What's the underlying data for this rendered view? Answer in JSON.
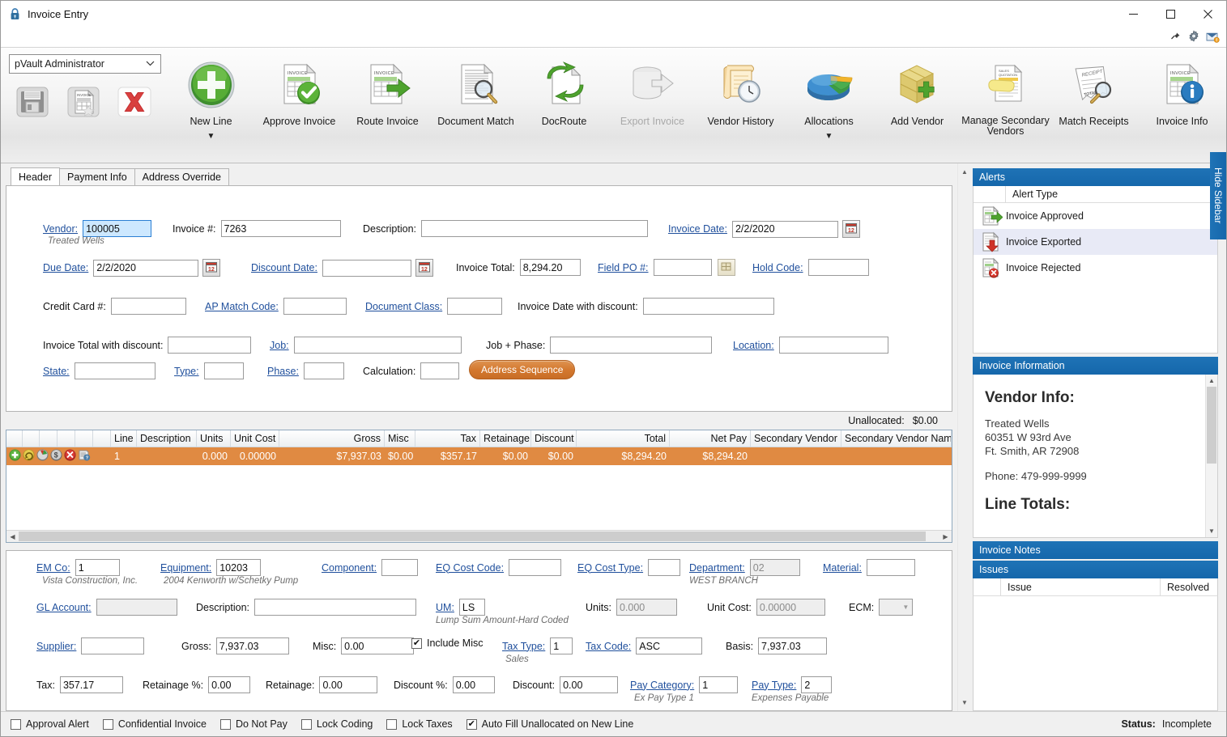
{
  "window": {
    "title": "Invoice Entry",
    "lock_icon": "lock-icon",
    "minimize": "—",
    "maximize": "☐",
    "close": "✕",
    "mini_icons": [
      "pin-icon",
      "gear-icon",
      "mail-alert-icon"
    ]
  },
  "toolbar": {
    "user": {
      "value": "pVault Administrator",
      "chevron": "⌄"
    },
    "small_buttons": [
      {
        "name": "save-button",
        "icon": "floppy-disk-icon"
      },
      {
        "name": "save-new-invoice-button",
        "icon": "invoice-sparkle-icon"
      },
      {
        "name": "delete-button",
        "icon": "red-x-icon"
      }
    ],
    "buttons": [
      {
        "label": "New Line",
        "icon": "green-plus-circle-icon",
        "caret": true,
        "disabled": false
      },
      {
        "label": "Approve Invoice",
        "icon": "invoice-check-icon",
        "caret": false,
        "disabled": false
      },
      {
        "label": "Route Invoice",
        "icon": "invoice-arrow-icon",
        "caret": false,
        "disabled": false
      },
      {
        "label": "Document Match",
        "icon": "document-magnifier-icon",
        "caret": false,
        "disabled": false
      },
      {
        "label": "DocRoute",
        "icon": "doc-route-arrows-icon",
        "caret": false,
        "disabled": false
      },
      {
        "label": "Export Invoice",
        "icon": "database-export-icon",
        "caret": false,
        "disabled": true
      },
      {
        "label": "Vendor History",
        "icon": "scroll-clock-icon",
        "caret": false,
        "disabled": false
      },
      {
        "label": "Allocations",
        "icon": "pie-chart-icon",
        "caret": true,
        "disabled": false
      },
      {
        "label": "Add Vendor",
        "icon": "package-plus-icon",
        "caret": false,
        "disabled": false
      },
      {
        "label": "Manage Secondary Vendors",
        "icon": "quotation-note-icon",
        "caret": false,
        "disabled": false
      },
      {
        "label": "Match Receipts",
        "icon": "receipt-magnifier-icon",
        "caret": false,
        "disabled": false
      },
      {
        "label": "Invoice Info",
        "icon": "invoice-info-icon",
        "caret": false,
        "disabled": false
      }
    ]
  },
  "tabs": [
    {
      "label": "Header",
      "active": true
    },
    {
      "label": "Payment Info",
      "active": false
    },
    {
      "label": "Address Override",
      "active": false
    }
  ],
  "header_form": {
    "vendor_label": "Vendor:",
    "vendor_value": "100005",
    "vendor_sub": "Treated Wells",
    "invoice_num_label": "Invoice #:",
    "invoice_num_value": "7263",
    "description_label": "Description:",
    "description_value": "",
    "invoice_date_label": "Invoice Date:",
    "invoice_date_value": "2/2/2020",
    "due_date_label": "Due Date:",
    "due_date_value": "2/2/2020",
    "discount_date_label": "Discount Date:",
    "discount_date_value": "",
    "invoice_total_label": "Invoice Total:",
    "invoice_total_value": "8,294.20",
    "field_po_label": "Field PO #:",
    "field_po_value": "",
    "hold_code_label": "Hold Code:",
    "hold_code_value": "",
    "credit_card_label": "Credit Card #:",
    "credit_card_value": "",
    "ap_match_code_label": "AP Match Code:",
    "ap_match_code_value": "",
    "document_class_label": "Document Class:",
    "document_class_value": "",
    "invoice_date_discount_label": "Invoice Date with discount:",
    "invoice_date_discount_value": "",
    "invoice_total_discount_label": "Invoice Total with discount:",
    "invoice_total_discount_value": "",
    "job_label": "Job:",
    "job_value": "",
    "job_phase_label": "Job + Phase:",
    "job_phase_value": "",
    "location_label": "Location:",
    "location_value": "",
    "state_label": "State:",
    "state_value": "",
    "type_label": "Type:",
    "type_value": "",
    "phase_label": "Phase:",
    "phase_value": "",
    "calculation_label": "Calculation:",
    "calculation_value": "",
    "address_sequence_button": "Address Sequence"
  },
  "unallocated": {
    "label": "Unallocated:",
    "value": "$0.00"
  },
  "grid": {
    "columns": [
      "Line",
      "Description",
      "Units",
      "Unit Cost",
      "Gross",
      "Misc",
      "Tax",
      "Retainage",
      "Discount",
      "Total",
      "Net Pay",
      "Secondary Vendor",
      "Secondary Vendor Name"
    ],
    "row_icons": [
      "add-line-icon",
      "copy-line-icon",
      "allocate-line-icon",
      "currency-line-icon",
      "delete-line-icon",
      "line-info-icon"
    ],
    "rows": [
      {
        "Line": "1",
        "Description": "",
        "Units": "0.000",
        "Unit Cost": "0.00000",
        "Gross": "$7,937.03",
        "Misc": "$0.00",
        "Tax": "$357.17",
        "Retainage": "$0.00",
        "Discount": "$0.00",
        "Total": "$8,294.20",
        "Net Pay": "$8,294.20",
        "Secondary Vendor": "",
        "Secondary Vendor Name": ""
      }
    ]
  },
  "detail_form": {
    "em_co_label": "EM Co:",
    "em_co_value": "1",
    "em_co_sub": "Vista Construction, Inc.",
    "equipment_label": "Equipment:",
    "equipment_value": "10203",
    "equipment_sub": "2004 Kenworth w/Schetky Pump",
    "component_label": "Component:",
    "component_value": "",
    "eq_cost_code_label": "EQ Cost Code:",
    "eq_cost_code_value": "",
    "eq_cost_type_label": "EQ Cost Type:",
    "eq_cost_type_value": "",
    "department_label": "Department:",
    "department_value": "02",
    "department_sub": "WEST BRANCH",
    "material_label": "Material:",
    "material_value": "",
    "gl_account_label": "GL Account:",
    "gl_account_value": "",
    "description_label": "Description:",
    "description_value": "",
    "um_label": "UM:",
    "um_value": "LS",
    "um_sub": "Lump Sum Amount-Hard Coded",
    "units_label": "Units:",
    "units_value": "0.000",
    "unit_cost_label": "Unit Cost:",
    "unit_cost_value": "0.00000",
    "ecm_label": "ECM:",
    "ecm_value": "",
    "supplier_label": "Supplier:",
    "supplier_value": "",
    "gross_label": "Gross:",
    "gross_value": "7,937.03",
    "misc_label": "Misc:",
    "misc_value": "0.00",
    "include_misc_label": "Include Misc",
    "include_misc_checked": true,
    "tax_type_label": "Tax Type:",
    "tax_type_value": "1",
    "tax_type_sub": "Sales",
    "tax_code_label": "Tax Code:",
    "tax_code_value": "ASC",
    "basis_label": "Basis:",
    "basis_value": "7,937.03",
    "tax_label": "Tax:",
    "tax_value": "357.17",
    "retainage_pct_label": "Retainage %:",
    "retainage_pct_value": "0.00",
    "retainage_label": "Retainage:",
    "retainage_value": "0.00",
    "discount_pct_label": "Discount %:",
    "discount_pct_value": "0.00",
    "discount_label": "Discount:",
    "discount_value": "0.00",
    "pay_category_label": "Pay Category:",
    "pay_category_value": "1",
    "pay_category_sub": "Ex Pay Type 1",
    "pay_type_label": "Pay Type:",
    "pay_type_value": "2",
    "pay_type_sub": "Expenses Payable"
  },
  "sidebar": {
    "hide_label": "Hide Sidebar",
    "alerts": {
      "title": "Alerts",
      "column": "Alert Type",
      "items": [
        {
          "label": "Invoice Approved",
          "icon": "invoice-green-arrow-icon",
          "selected": false
        },
        {
          "label": "Invoice Exported",
          "icon": "invoice-red-arrow-icon",
          "selected": true
        },
        {
          "label": "Invoice Rejected",
          "icon": "invoice-red-x-icon",
          "selected": false
        }
      ]
    },
    "invoice_information": {
      "title": "Invoice Information",
      "vendor_heading": "Vendor Info:",
      "vendor_name": "Treated Wells",
      "vendor_address1": "60351 W 93rd Ave",
      "vendor_address2": "Ft. Smith, AR 72908",
      "vendor_phone": "Phone: 479-999-9999",
      "line_totals_heading": "Line Totals:"
    },
    "invoice_notes_title": "Invoice Notes",
    "issues_title": "Issues",
    "issues_columns": [
      "Issue",
      "Resolved"
    ],
    "issues_rows": []
  },
  "statusbar": {
    "checkboxes": [
      {
        "label": "Approval Alert",
        "checked": false
      },
      {
        "label": "Confidential Invoice",
        "checked": false
      },
      {
        "label": "Do Not Pay",
        "checked": false
      },
      {
        "label": "Lock Coding",
        "checked": false
      },
      {
        "label": "Lock Taxes",
        "checked": false
      },
      {
        "label": "Auto Fill Unallocated on New Line",
        "checked": true
      }
    ],
    "status_label": "Status:",
    "status_value": "Incomplete"
  },
  "colors": {
    "accent_blue": "#1567ab",
    "grid_row": "#e08a42",
    "link": "#1f4f9c",
    "button_orange": "#d4792f"
  }
}
